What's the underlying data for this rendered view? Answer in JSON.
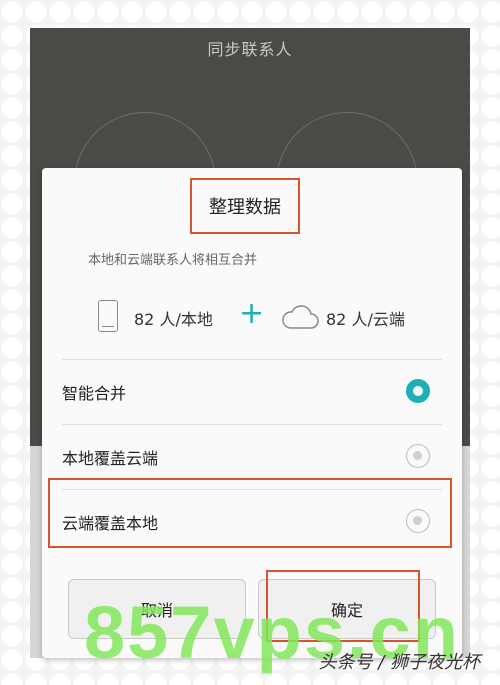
{
  "background": {
    "screen_title": "同步联系人"
  },
  "dialog": {
    "title": "整理数据",
    "subtitle": "本地和云端联系人将相互合并",
    "local_count": "82 人/本地",
    "plus": "+",
    "cloud_count": "82 人/云端",
    "options": [
      {
        "label": "智能合并",
        "selected": true
      },
      {
        "label": "本地覆盖云端",
        "selected": false
      },
      {
        "label": "云端覆盖本地",
        "selected": false
      }
    ],
    "cancel_label": "取消",
    "confirm_label": "确定"
  },
  "watermark": {
    "text": "857vps.cn",
    "credit": "头条号 / 狮子夜光杯"
  },
  "colors": {
    "accent": "#1ab0b5",
    "highlight": "#d5542c"
  },
  "icons": [
    "phone-icon",
    "plus-icon",
    "cloud-icon",
    "radio-checked-icon",
    "radio-unchecked-icon"
  ]
}
